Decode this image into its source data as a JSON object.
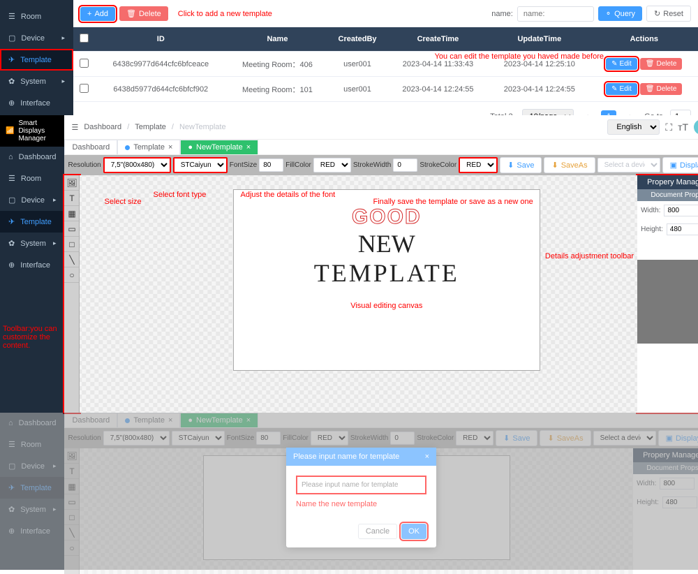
{
  "top": {
    "sidebar": {
      "items": [
        {
          "label": "Room",
          "icon": "☰"
        },
        {
          "label": "Device",
          "icon": "▢"
        },
        {
          "label": "Template",
          "icon": "✈"
        },
        {
          "label": "System",
          "icon": "✿"
        },
        {
          "label": "Interface",
          "icon": "⊕"
        }
      ]
    },
    "toolbar": {
      "add": "Add",
      "delete": "Delete",
      "name_lbl": "name:",
      "query": "Query",
      "reset": "Reset"
    },
    "annot_add": "Click to add a new template",
    "annot_edit": "You can edit the template you haved made before",
    "table": {
      "headers": {
        "id": "ID",
        "name": "Name",
        "createdBy": "CreatedBy",
        "createTime": "CreateTime",
        "updateTime": "UpdateTime",
        "actions": "Actions"
      },
      "rows": [
        {
          "id": "6438c9977d644cfc6bfceace",
          "name": "Meeting Room：406",
          "createdBy": "user001",
          "createTime": "2023-04-14 11:33:43",
          "updateTime": "2023-04-14 12:25:10"
        },
        {
          "id": "6438d5977d644cfc6bfcf902",
          "name": "Meeting Room：101",
          "createdBy": "user001",
          "createTime": "2023-04-14 12:24:55",
          "updateTime": "2023-04-14 12:24:55"
        }
      ],
      "edit": "Edit",
      "del": "Delete"
    },
    "pager": {
      "total": "Total 2.",
      "perpage": "10/page",
      "page": "1",
      "goto": "Go to",
      "gotoVal": "1"
    }
  },
  "editor": {
    "brand": "Smart Displays Manager",
    "sidebar": {
      "items": [
        {
          "label": "Dashboard",
          "icon": "⌂"
        },
        {
          "label": "Room",
          "icon": "☰"
        },
        {
          "label": "Device",
          "icon": "▢"
        },
        {
          "label": "Template",
          "icon": "✈"
        },
        {
          "label": "System",
          "icon": "✿"
        },
        {
          "label": "Interface",
          "icon": "⊕"
        }
      ]
    },
    "bc": {
      "a": "Dashboard",
      "b": "Template",
      "c": "NewTemplate"
    },
    "lang": "English",
    "tabs": {
      "a": "Dashboard",
      "b": "Template",
      "c": "NewTemplate"
    },
    "toolbar": {
      "resolution": "Resolution",
      "resVal": "7,5\"(800x480)",
      "font": "STCaiyun",
      "fontSize": "FontSize",
      "fontSizeVal": "80",
      "fillColor": "FillColor",
      "fillVal": "RED",
      "strokeWidth": "StrokeWidth",
      "swVal": "0",
      "strokeColor": "StrokeColor",
      "scVal": "RED",
      "save": "Save",
      "saveAs": "SaveAs",
      "device": "Select a device",
      "display": "Display"
    },
    "canvas": {
      "good": "GOOD",
      "new": "NEW",
      "template": "TEMPLATE",
      "label": "Visual editing canvas"
    },
    "prop": {
      "title": "Propery Manager",
      "sub": "Document Props",
      "width": "Width:",
      "widthVal": "800",
      "height": "Height:",
      "heightVal": "480"
    },
    "annot": {
      "size": "Select size",
      "font": "Select font type",
      "details": "Adjust the details of the font",
      "save": "Finally save the template or save as a new one",
      "prop": "Details adjustment toolbar",
      "toolbar": "Toolbar:you can customize the content."
    }
  },
  "modal": {
    "title": "Please input name for template",
    "placeholder": "Please input name for template",
    "label": "Name the new template",
    "cancel": "Cancle",
    "ok": "OK"
  }
}
